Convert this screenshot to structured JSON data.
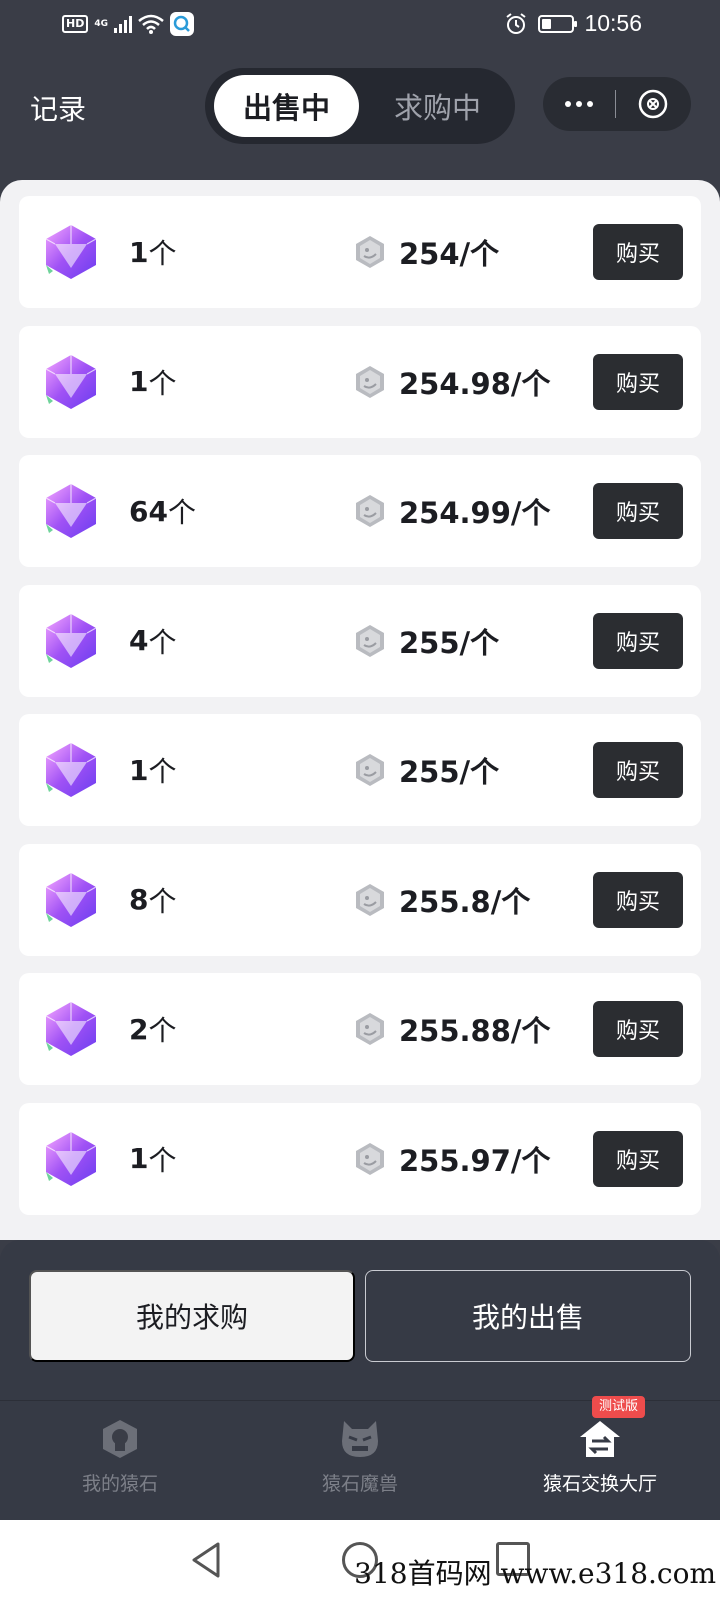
{
  "status_bar": {
    "hd": "HD",
    "network": "4G",
    "time": "10:56",
    "icons": [
      "hd-icon",
      "signal-icon",
      "wifi-icon",
      "app-notification-icon",
      "alarm-icon",
      "battery-icon"
    ],
    "battery_level": 0.3
  },
  "header": {
    "records_label": "记录",
    "tabs": [
      {
        "label": "出售中",
        "active": true
      },
      {
        "label": "求购中",
        "active": false
      }
    ],
    "capsule": {
      "more_icon": "more-icon",
      "close_icon": "close-circle-icon"
    }
  },
  "listings": [
    {
      "qty": "1",
      "unit": "个",
      "price": "254/个",
      "buy_label": "购买"
    },
    {
      "qty": "1",
      "unit": "个",
      "price": "254.98/个",
      "buy_label": "购买"
    },
    {
      "qty": "64",
      "unit": "个",
      "price": "254.99/个",
      "buy_label": "购买"
    },
    {
      "qty": "4",
      "unit": "个",
      "price": "255/个",
      "buy_label": "购买"
    },
    {
      "qty": "1",
      "unit": "个",
      "price": "255/个",
      "buy_label": "购买"
    },
    {
      "qty": "8",
      "unit": "个",
      "price": "255.8/个",
      "buy_label": "购买"
    },
    {
      "qty": "2",
      "unit": "个",
      "price": "255.88/个",
      "buy_label": "购买"
    },
    {
      "qty": "1",
      "unit": "个",
      "price": "255.97/个",
      "buy_label": "购买"
    }
  ],
  "actions": {
    "my_buy_requests": "我的求购",
    "my_sales": "我的出售"
  },
  "tabbar": {
    "tabs": [
      {
        "label": "我的猿石",
        "icon": "ape-stone-icon",
        "active": false
      },
      {
        "label": "猿石魔兽",
        "icon": "monster-icon",
        "active": false
      },
      {
        "label": "猿石交换大厅",
        "icon": "exchange-hall-icon",
        "active": true
      }
    ],
    "badge": "测试版"
  },
  "watermark": "318首码网 www.e318.com",
  "colors": {
    "header_bg": "#3a3d47",
    "panel_bg": "#f2f2f4",
    "buy_button": "#2b2d31",
    "badge": "#ee4c4c"
  }
}
